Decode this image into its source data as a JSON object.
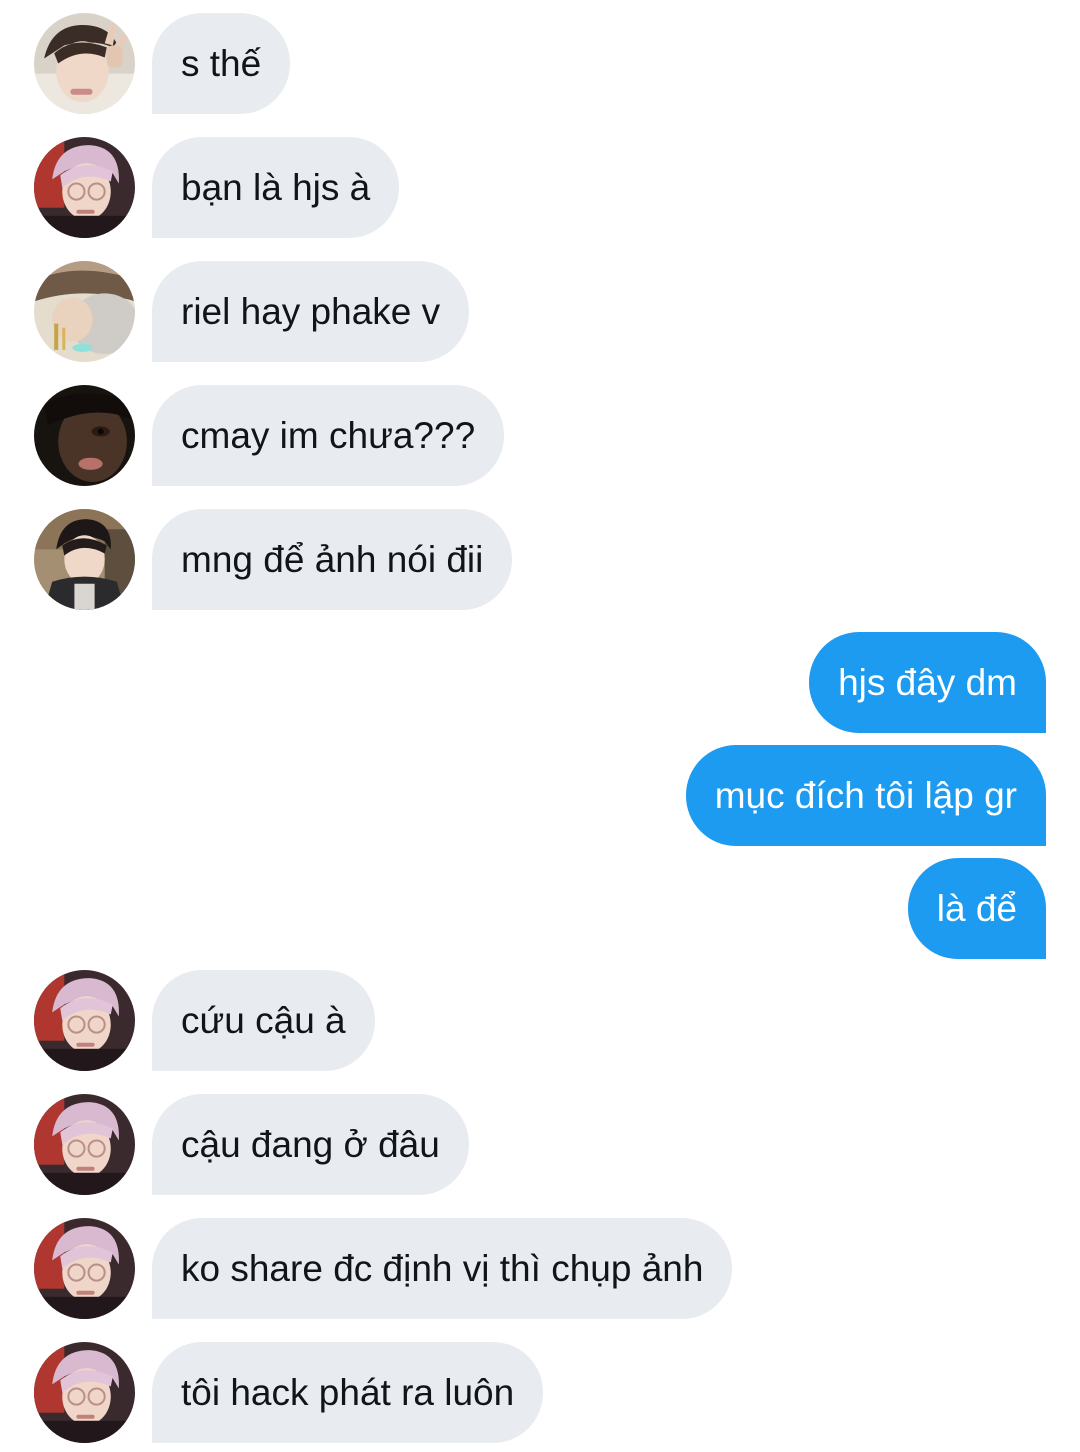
{
  "conversation": {
    "messages": [
      {
        "side": "in",
        "avatar": "avatar-boy-peace-sign",
        "text": "s thế"
      },
      {
        "side": "in",
        "avatar": "avatar-pink-hair-glasses",
        "text": "bạn là hjs à"
      },
      {
        "side": "in",
        "avatar": "avatar-sleeping-face",
        "text": "riel hay phake v"
      },
      {
        "side": "in",
        "avatar": "avatar-dark-closeup",
        "text": "cmay im chưa???"
      },
      {
        "side": "in",
        "avatar": "avatar-boy-room",
        "text": "mng để ảnh nói đii"
      },
      {
        "side": "out",
        "text": "hjs đây dm"
      },
      {
        "side": "out",
        "text": "mục đích tôi lập gr"
      },
      {
        "side": "out",
        "text": "là để"
      },
      {
        "side": "in",
        "avatar": "avatar-pink-hair-glasses",
        "text": "cứu cậu à"
      },
      {
        "side": "in",
        "avatar": "avatar-pink-hair-glasses",
        "text": "cậu đang ở đâu"
      },
      {
        "side": "in",
        "avatar": "avatar-pink-hair-glasses",
        "text": "ko share đc định vị thì chụp ảnh"
      },
      {
        "side": "in",
        "avatar": "avatar-pink-hair-glasses",
        "text": "tôi hack phát ra luôn"
      }
    ]
  },
  "colors": {
    "incoming_bubble": "#e8ecf0",
    "outgoing_bubble": "#1d9bf0",
    "incoming_text": "#111418",
    "outgoing_text": "#ffffff"
  }
}
